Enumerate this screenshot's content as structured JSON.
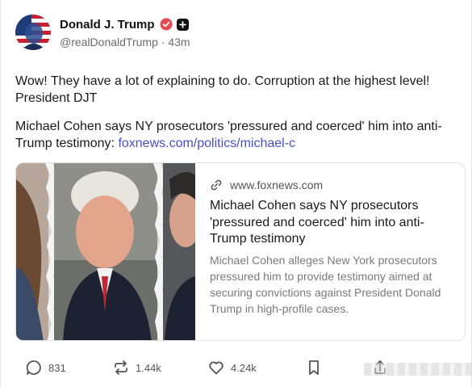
{
  "post": {
    "author": {
      "name": "Donald J. Trump",
      "handle": "@realDonaldTrump",
      "separator": "·",
      "time": "43m",
      "verified_color": "#e5484d",
      "avatar_icon": "avatar-portrait"
    },
    "body_line1": "Wow! They have a lot of explaining to do. Corruption at the highest level! President DJT",
    "body_line2_prefix": "Michael Cohen says NY prosecutors 'pressured and coerced' him into anti-Trump testimony: ",
    "body_link": "foxnews.com/politics/michael-c",
    "link_color": "#4a4fd0"
  },
  "card": {
    "domain": "www.foxnews.com",
    "title": "Michael Cohen says NY prosecutors 'pressured and coerced' him into anti-Trump testimony",
    "description": "Michael Cohen alleges New York prosecutors pressured him to provide testimony aimed at securing convictions against President Donald Trump in high-profile cases."
  },
  "actions": {
    "replies": "831",
    "reposts": "1.44k",
    "likes": "4.24k"
  }
}
